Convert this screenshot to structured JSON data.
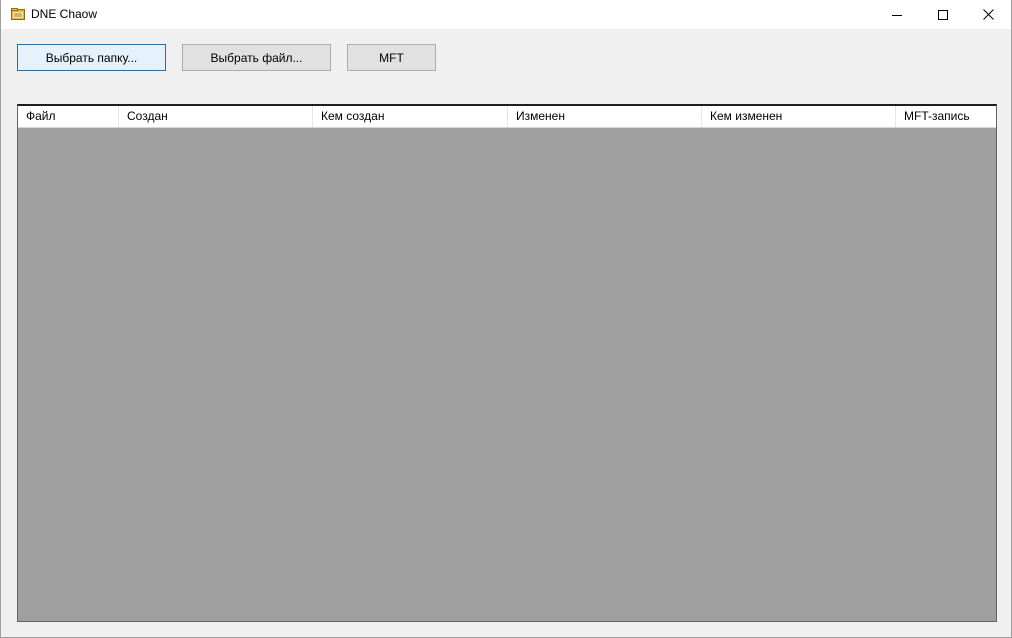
{
  "window": {
    "title": "DNE Chaow",
    "icon": "folder-app-icon"
  },
  "toolbar": {
    "select_folder_label": "Выбрать папку...",
    "select_file_label": "Выбрать файл...",
    "mft_label": "MFT"
  },
  "table": {
    "columns": [
      "Файл",
      "Создан",
      "Кем создан",
      "Изменен",
      "Кем изменен",
      "MFT-запись"
    ],
    "rows": []
  },
  "colors": {
    "window_bg": "#f0f0f0",
    "list_bg": "#a0a0a0",
    "focus_accent": "#0078d7"
  }
}
